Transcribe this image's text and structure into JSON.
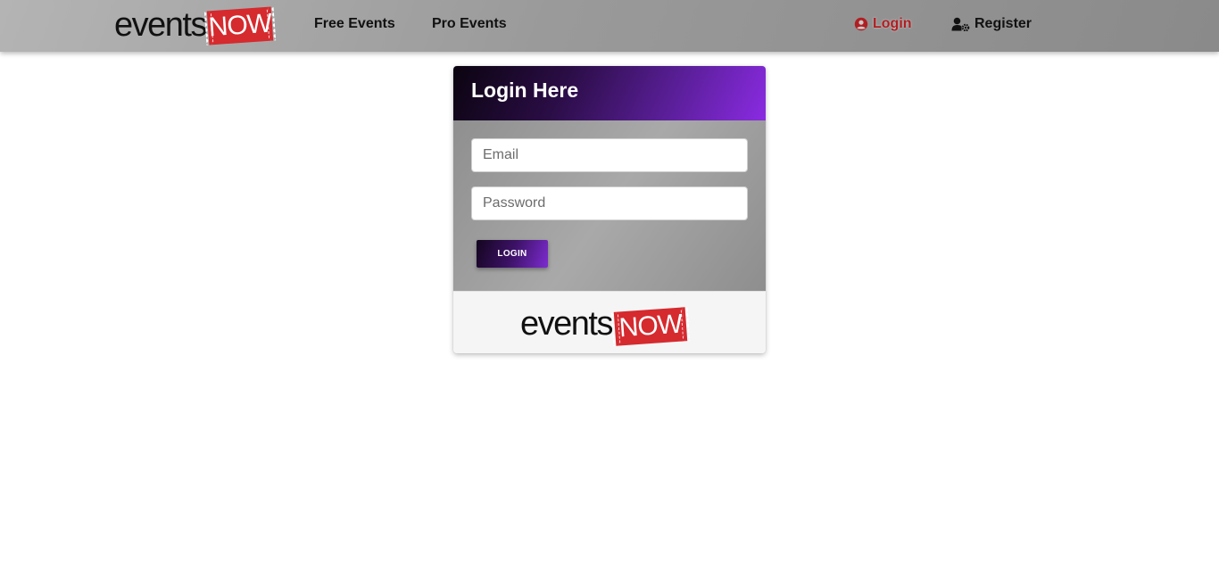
{
  "brand": {
    "word": "events",
    "ticket": "NOW",
    "ticket_color": "#d52a2e"
  },
  "nav": {
    "free_events": "Free Events",
    "pro_events": "Pro Events",
    "login": "Login",
    "register": "Register",
    "login_color": "#b11e22",
    "login_icon": "user-circle-icon",
    "register_icon": "user-gear-icon"
  },
  "login_card": {
    "title": "Login Here",
    "email_placeholder": "Email",
    "password_placeholder": "Password",
    "submit_label": "LOGIN",
    "accent_color": "#8a2be2"
  }
}
